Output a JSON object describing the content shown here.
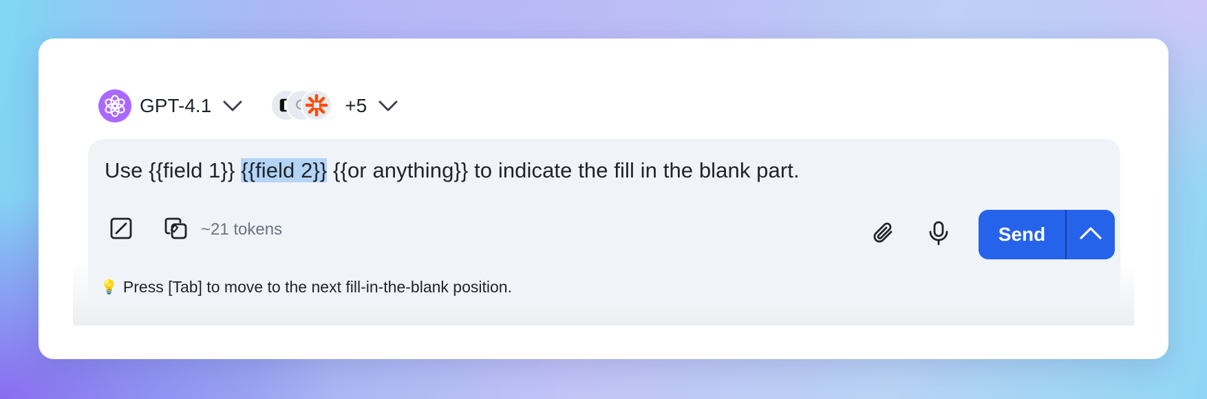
{
  "model_selector": {
    "label": "GPT-4.1",
    "logo_icon": "openai-logo-icon",
    "logo_color": "#ab68ff"
  },
  "tools_selector": {
    "extra_count": "+5",
    "tool_icons": [
      "notion-icon",
      "search-icon",
      "zapier-icon"
    ],
    "zapier_color": "#ff4a00"
  },
  "composer": {
    "prompt_before": "Use {{field 1}} ",
    "prompt_highlight": "{{field 2}}",
    "prompt_after": " {{or anything}} to indicate the fill in the blank part.",
    "tokens": "~21 tokens",
    "send_label": "Send",
    "accent_color": "#2563eb",
    "highlight_color": "#b3d4f7"
  },
  "hint": {
    "icon": "💡",
    "text": "Press [Tab] to move to the next fill-in-the-blank position."
  }
}
